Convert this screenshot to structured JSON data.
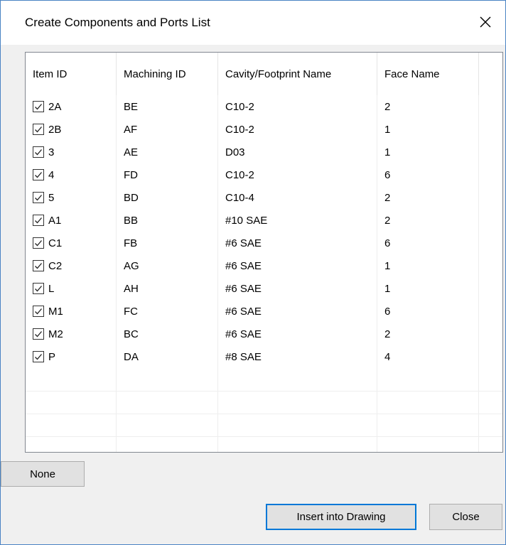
{
  "window": {
    "title": "Create Components and Ports List"
  },
  "table": {
    "columns": [
      "Item ID",
      "Machining ID",
      "Cavity/Footprint Name",
      "Face Name"
    ],
    "rows": [
      {
        "item_id": "2A",
        "machining_id": "BE",
        "cavity": "C10-2",
        "face": "2",
        "checked": true
      },
      {
        "item_id": "2B",
        "machining_id": "AF",
        "cavity": "C10-2",
        "face": "1",
        "checked": true
      },
      {
        "item_id": "3",
        "machining_id": "AE",
        "cavity": "D03",
        "face": "1",
        "checked": true
      },
      {
        "item_id": "4",
        "machining_id": "FD",
        "cavity": "C10-2",
        "face": "6",
        "checked": true
      },
      {
        "item_id": "5",
        "machining_id": "BD",
        "cavity": "C10-4",
        "face": "2",
        "checked": true
      },
      {
        "item_id": "A1",
        "machining_id": "BB",
        "cavity": "#10 SAE",
        "face": "2",
        "checked": true
      },
      {
        "item_id": "C1",
        "machining_id": "FB",
        "cavity": "#6 SAE",
        "face": "6",
        "checked": true
      },
      {
        "item_id": "C2",
        "machining_id": "AG",
        "cavity": "#6 SAE",
        "face": "1",
        "checked": true
      },
      {
        "item_id": "L",
        "machining_id": "AH",
        "cavity": "#6 SAE",
        "face": "1",
        "checked": true
      },
      {
        "item_id": "M1",
        "machining_id": "FC",
        "cavity": "#6 SAE",
        "face": "6",
        "checked": true
      },
      {
        "item_id": "M2",
        "machining_id": "BC",
        "cavity": "#6 SAE",
        "face": "2",
        "checked": true
      },
      {
        "item_id": "P",
        "machining_id": "DA",
        "cavity": "#8 SAE",
        "face": "4",
        "checked": true
      }
    ]
  },
  "buttons": {
    "none": "None",
    "insert": "Insert into Drawing",
    "close": "Close"
  },
  "icons": {
    "close": "close-icon",
    "checkbox": "checkbox-checked-icon"
  },
  "colors": {
    "accent": "#0078d7",
    "frame": "#4a83c4"
  }
}
